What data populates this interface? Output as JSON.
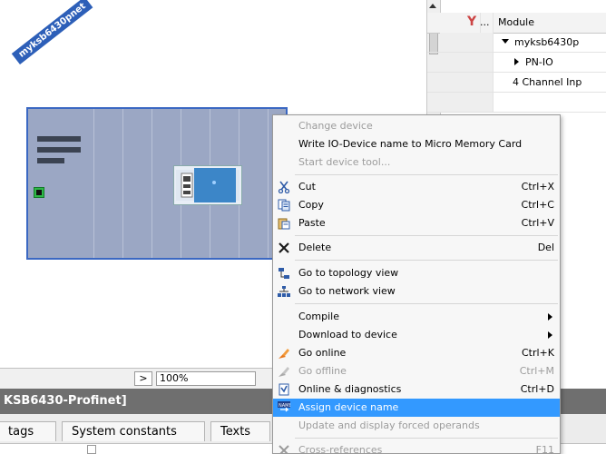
{
  "device": {
    "name": "myksb6430pnet"
  },
  "table": {
    "header": {
      "col_module": "Module",
      "col_dots": "..."
    },
    "rows": [
      {
        "label": "myksb6430p",
        "expander": "down"
      },
      {
        "label": "PN-IO",
        "expander": "right"
      },
      {
        "label": "4 Channel Inp",
        "expander": ""
      }
    ]
  },
  "context_menu": {
    "items": [
      {
        "label": "Change device",
        "shortcut": "",
        "disabled": true
      },
      {
        "label": "Write IO-Device name to Micro Memory Card",
        "shortcut": "",
        "disabled": false
      },
      {
        "label": "Start device tool...",
        "shortcut": "",
        "disabled": true
      },
      {
        "label": "Cut",
        "shortcut": "Ctrl+X",
        "icon": "scissors-icon"
      },
      {
        "label": "Copy",
        "shortcut": "Ctrl+C",
        "icon": "copy-icon"
      },
      {
        "label": "Paste",
        "shortcut": "Ctrl+V",
        "icon": "paste-icon"
      },
      {
        "label": "Delete",
        "shortcut": "Del",
        "icon": "delete-icon"
      },
      {
        "label": "Go to topology view",
        "shortcut": "",
        "icon": "topology-icon"
      },
      {
        "label": "Go to network view",
        "shortcut": "",
        "icon": "network-icon"
      },
      {
        "label": "Compile",
        "shortcut": "",
        "submenu": true
      },
      {
        "label": "Download to device",
        "shortcut": "",
        "submenu": true
      },
      {
        "label": "Go online",
        "shortcut": "Ctrl+K",
        "icon": "go-online-icon"
      },
      {
        "label": "Go offline",
        "shortcut": "Ctrl+M",
        "icon": "go-offline-icon",
        "disabled": true
      },
      {
        "label": "Online & diagnostics",
        "shortcut": "Ctrl+D",
        "icon": "diagnostics-icon"
      },
      {
        "label": "Assign device name",
        "shortcut": "",
        "icon": "assign-name-icon",
        "highlighted": true
      },
      {
        "label": "Update and display forced operands",
        "shortcut": "",
        "disabled": true
      },
      {
        "label": "Cross-references",
        "shortcut": "F11",
        "icon": "cross-ref-icon",
        "disabled": true
      }
    ]
  },
  "zoom": {
    "value": "100%",
    "arrow": ">"
  },
  "title": {
    "text": "KSB6430-Profinet]"
  },
  "tabs": [
    "tags",
    "System constants",
    "Texts"
  ],
  "colors": {
    "highlight": "#3399ff",
    "rack_border": "#3b68c2",
    "title_bar": "#6f6f6f"
  }
}
